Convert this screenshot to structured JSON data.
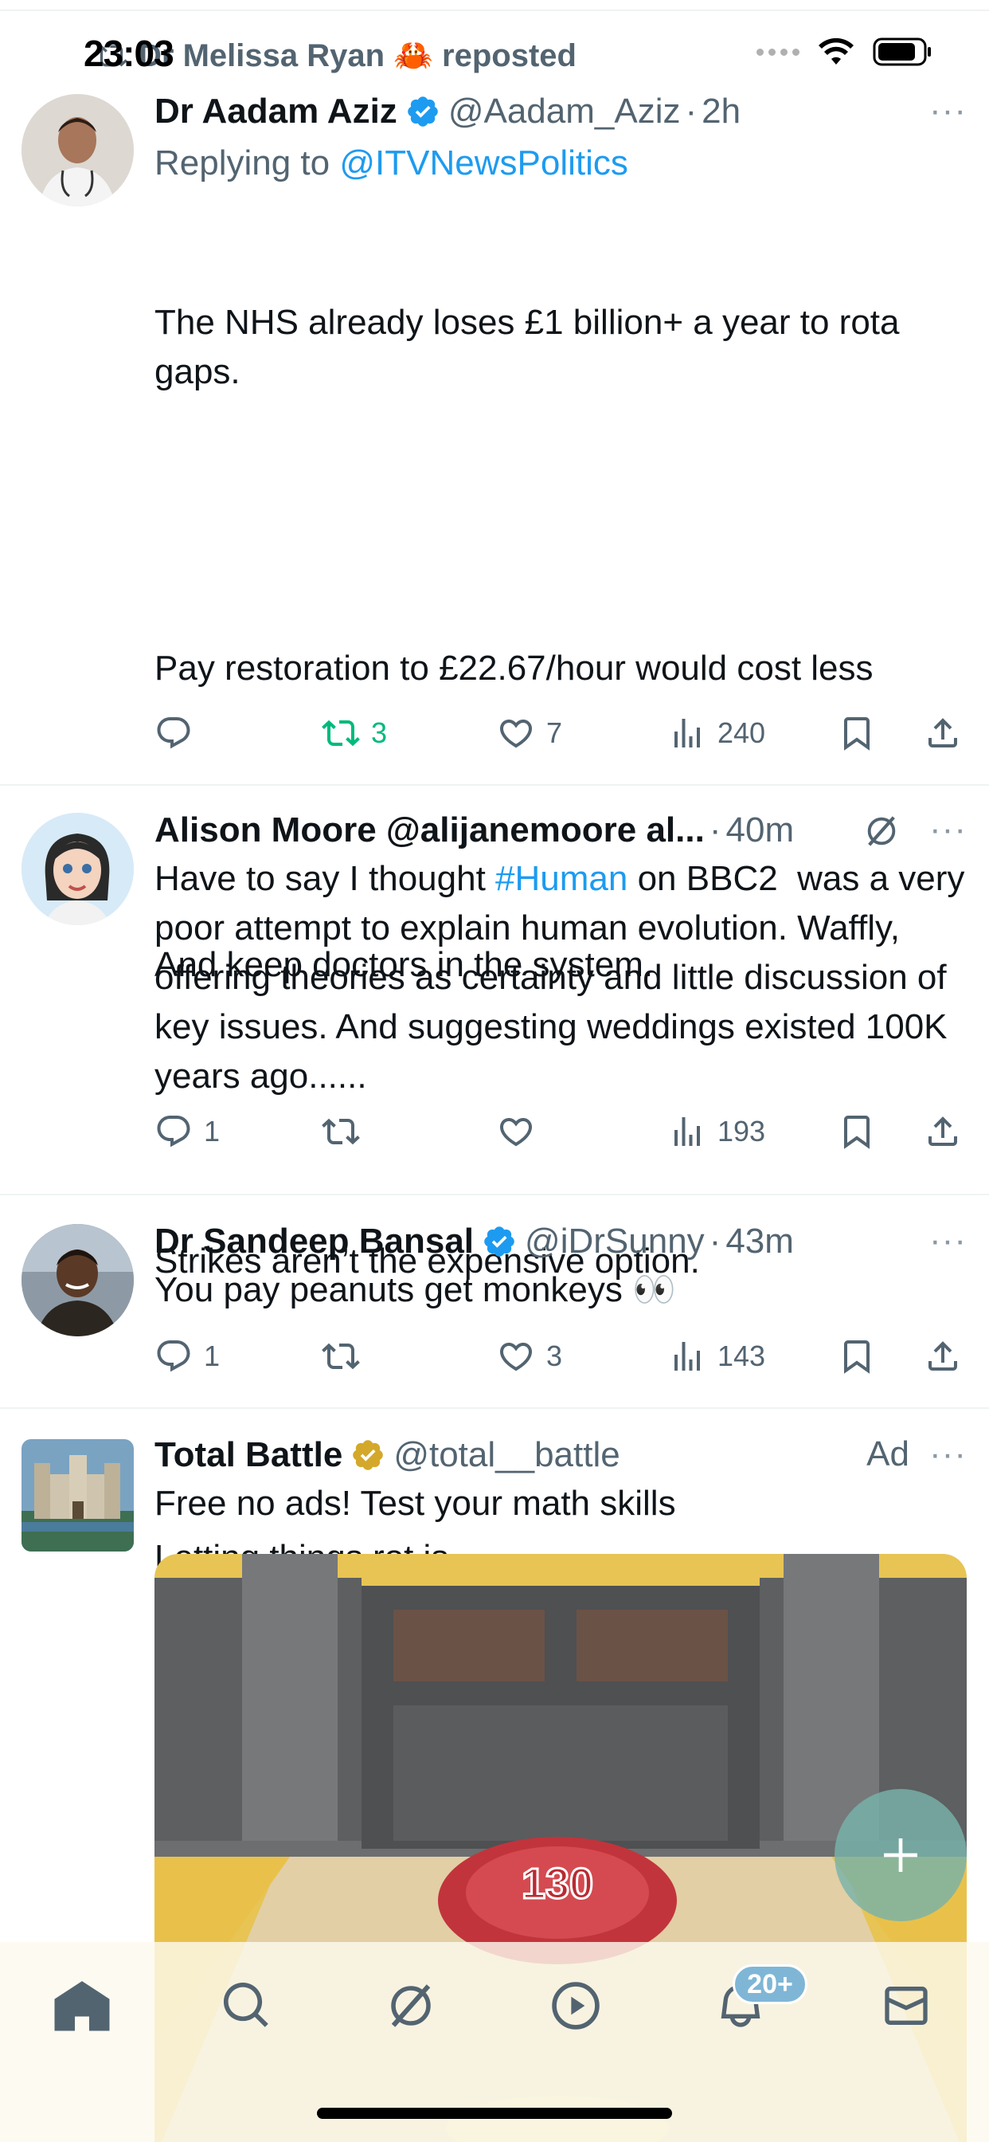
{
  "status_bar": {
    "time": "23:03"
  },
  "repost_line": {
    "text": "Dr Melissa Ryan 🦀 reposted"
  },
  "tweets": [
    {
      "display_name": "Dr Aadam Aziz",
      "handle": "@Aadam_Aziz",
      "time": "2h",
      "reply_prefix": "Replying to ",
      "reply_to": "@ITVNewsPolitics",
      "paragraphs": [
        "The NHS already loses £1 billion+ a year to rota gaps.",
        "Pay restoration to £22.67/hour would cost less",
        "And keep doctors in the system.",
        "Strikes aren’t the expensive option.",
        "Letting things rot is."
      ],
      "counts": {
        "replies": "",
        "reposts": "3",
        "likes": "7",
        "views": "240"
      }
    },
    {
      "display_name": "Alison Moore @alijanemoore al...",
      "time": "40m",
      "text_before": "Have to say I thought ",
      "hashtag": "#Human",
      "text_after": " on BBC2  was a very poor attempt to explain human evolution. Waffly, offering theories as certainty and little discussion of key issues. And suggesting weddings existed 100K years ago......",
      "counts": {
        "replies": "1",
        "reposts": "",
        "likes": "",
        "views": "193"
      }
    },
    {
      "display_name": "Dr Sandeep Bansal",
      "handle": "@iDrSunny",
      "time": "43m",
      "text": "You pay peanuts get monkeys 👀",
      "counts": {
        "replies": "1",
        "reposts": "",
        "likes": "3",
        "views": "143"
      }
    },
    {
      "display_name": "Total Battle",
      "handle": "@total__battle",
      "ad_label": "Ad",
      "text": "Free no ads! Test your math skills",
      "image_number": "130"
    }
  ],
  "more_glyph": "···",
  "notifications_badge": "20+",
  "colors": {
    "accent": "#1d9bf0",
    "repost_green": "#00ba7c",
    "muted": "#536471",
    "gold_badge": "#d4a82a"
  }
}
